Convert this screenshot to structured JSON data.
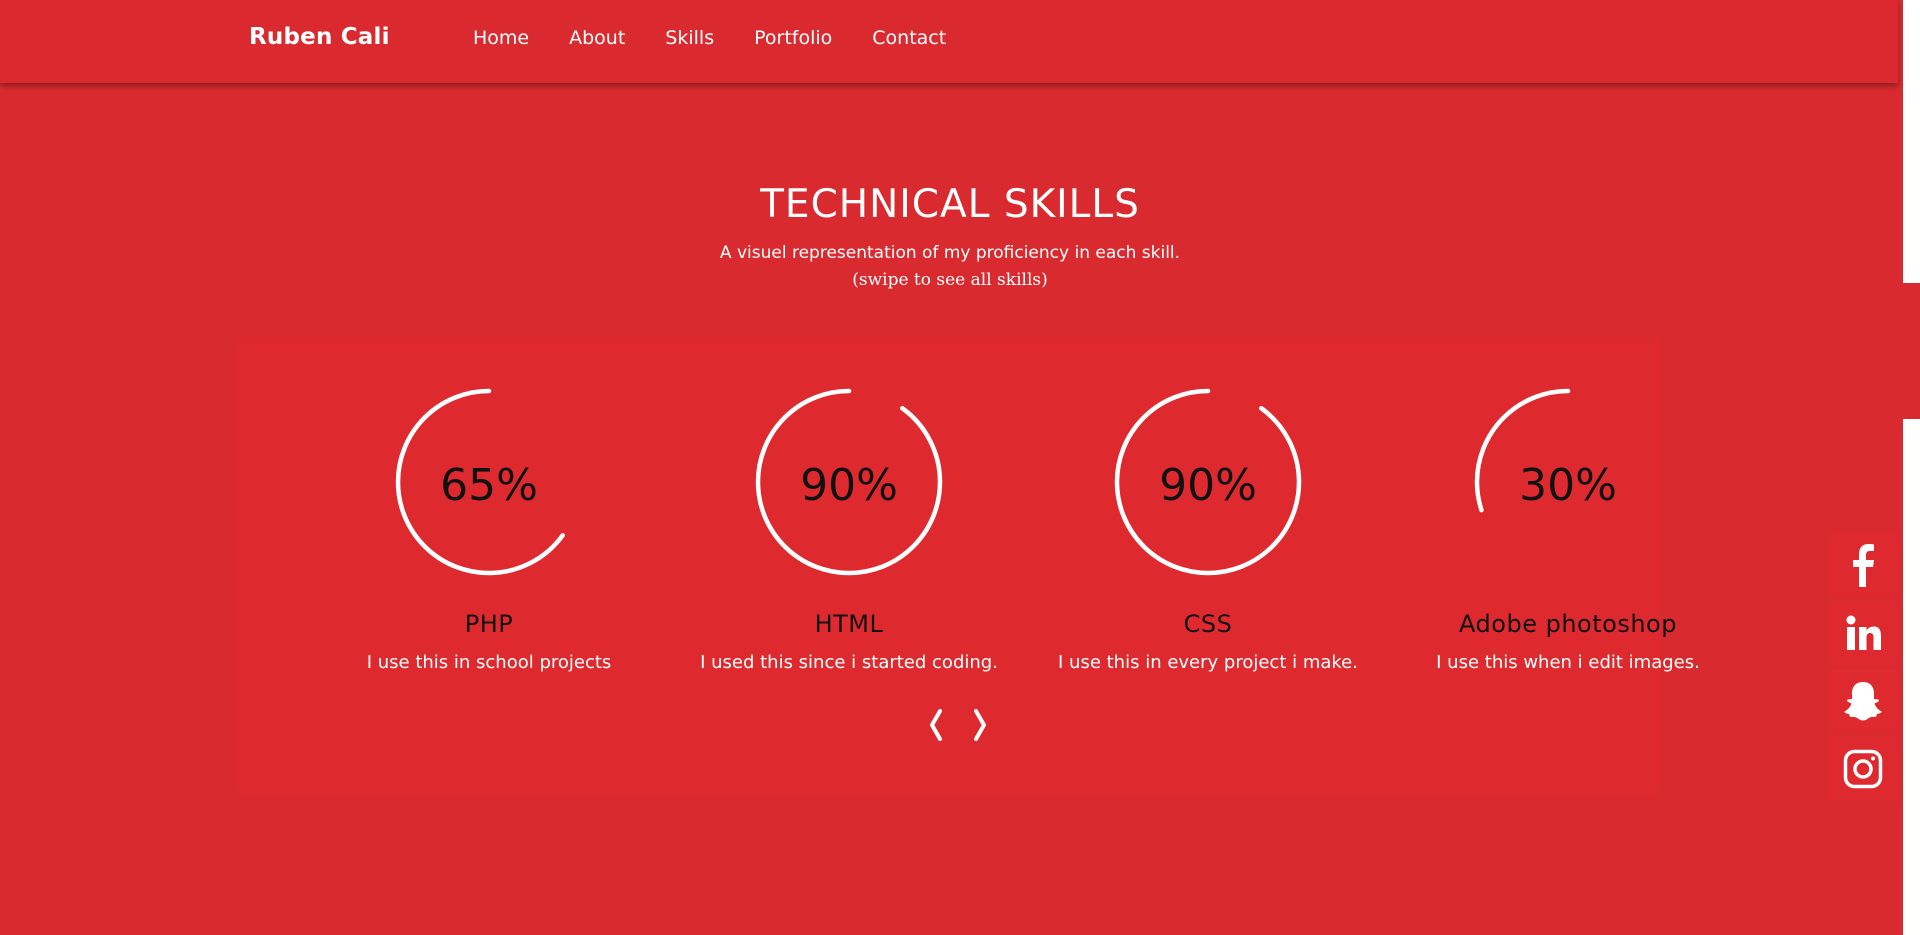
{
  "navbar": {
    "brand": "Ruben Cali",
    "links": [
      "Home",
      "About",
      "Skills",
      "Portfolio",
      "Contact"
    ]
  },
  "section": {
    "title": "TECHNICAL SKILLS",
    "subtitle": "A visuel representation of my proficiency in each skill.",
    "hint": "(swipe to see all skills)"
  },
  "skills": [
    {
      "percent_label": "65%",
      "value": 65,
      "name": "PHP",
      "description": "I use this in school projects"
    },
    {
      "percent_label": "90%",
      "value": 90,
      "name": "HTML",
      "description": "I used this since i started coding."
    },
    {
      "percent_label": "90%",
      "value": 90,
      "name": "CSS",
      "description": "I use this in every project i make."
    },
    {
      "percent_label": "30%",
      "value": 30,
      "name": "Adobe photoshop",
      "description": "I use this when i edit images."
    }
  ],
  "carousel": {
    "prev_icon": "chevron-left-icon",
    "next_icon": "chevron-right-icon"
  },
  "social": [
    "facebook-icon",
    "linkedin-icon",
    "snapchat-icon",
    "instagram-icon"
  ],
  "colors": {
    "background": "#d92b2f",
    "ring": "#ffffff",
    "percent_text": "#111111"
  }
}
